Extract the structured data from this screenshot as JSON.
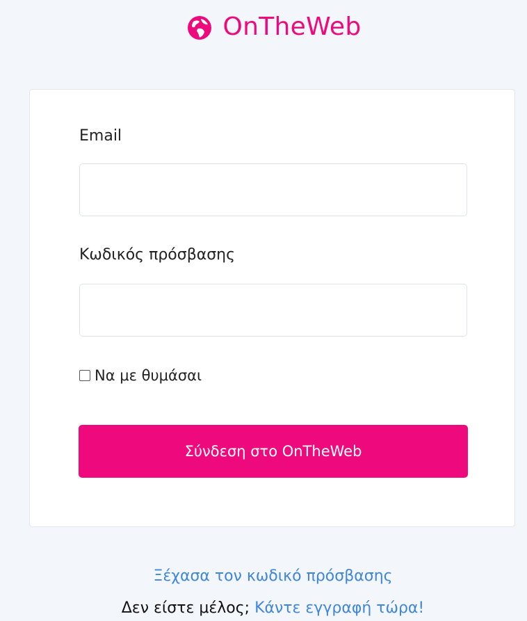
{
  "brand": {
    "icon": "globe-icon",
    "name": "OnTheWeb",
    "color": "#ee0a7d"
  },
  "form": {
    "email_label": "Email",
    "email_value": "",
    "password_label": "Κωδικός πρόσβασης",
    "password_value": "",
    "remember_label": "Να με θυμάσαι",
    "remember_checked": false,
    "submit_label": "Σύνδεση στο OnTheWeb",
    "accent_color": "#ee0a7d"
  },
  "footer": {
    "forgot_password": "Ξέχασα τον κωδικό πρόσβασης",
    "not_member": "Δεν είστε μέλος;",
    "signup_link": "Κάντε εγγραφή τώρα!",
    "link_color": "#3f86dc"
  }
}
